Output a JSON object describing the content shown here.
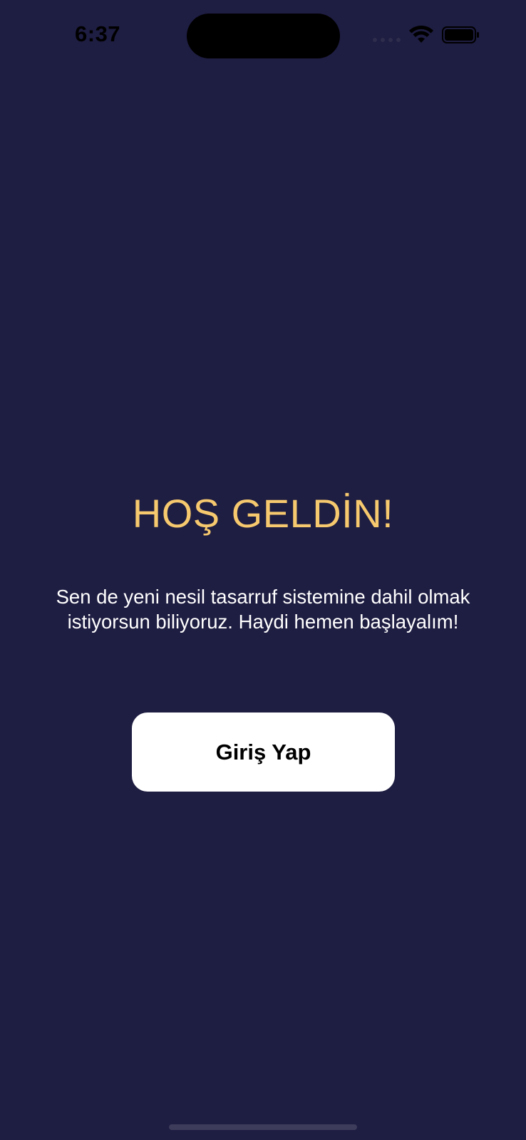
{
  "status_bar": {
    "time": "6:37",
    "icons": [
      "signal-dots-icon",
      "wifi-icon",
      "battery-icon"
    ]
  },
  "welcome": {
    "title": "HOŞ GELDİN!",
    "subtitle_line1": "Sen de yeni nesil tasarruf sistemine dahil olmak",
    "subtitle_line2": "istiyorsun biliyoruz. Haydi hemen başlayalım!"
  },
  "actions": {
    "login_label": "Giriş Yap"
  },
  "colors": {
    "background": "#1e1d42",
    "title": "#f6c96e",
    "text": "#ffffff",
    "button_bg": "#ffffff",
    "button_text": "#000000"
  }
}
